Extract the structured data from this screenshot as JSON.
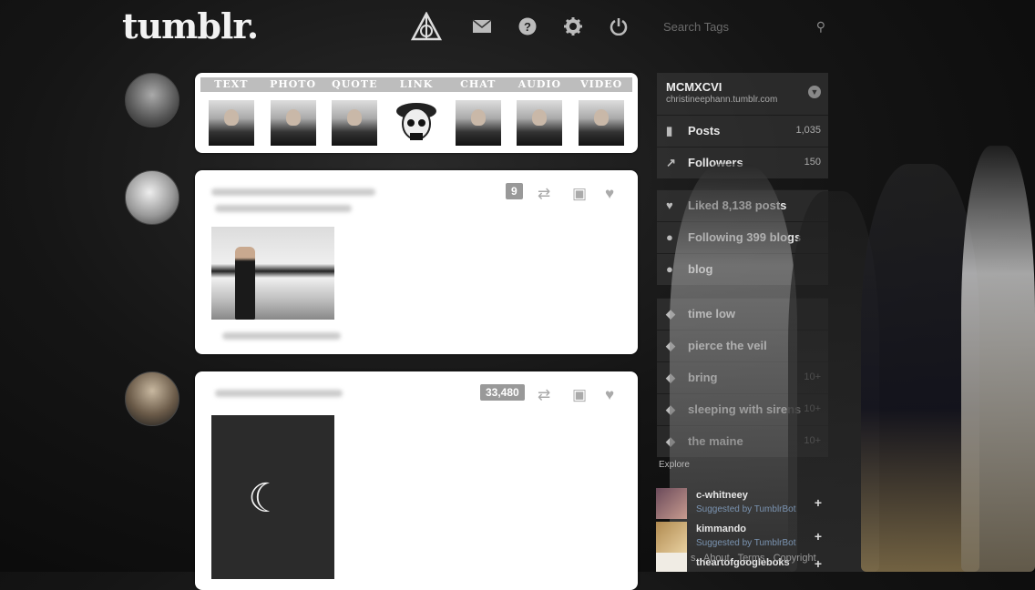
{
  "header": {
    "logo": "tumblr.",
    "nav_icons": [
      "deathly-hallows-icon",
      "mail-icon",
      "help-icon",
      "gear-icon",
      "power-icon"
    ],
    "search_placeholder": "Search Tags"
  },
  "post_types": [
    "TEXT",
    "PHOTO",
    "QUOTE",
    "LINK",
    "CHAT",
    "AUDIO",
    "VIDEO"
  ],
  "posts": [
    {
      "note_count": "9"
    },
    {
      "note_count": "33,480"
    }
  ],
  "sidebar": {
    "blog_name": "MCMXCVI",
    "blog_url": "christineephann.tumblr.com",
    "posts_label": "Posts",
    "posts_count": "1,035",
    "followers_label": "Followers",
    "followers_count": "150",
    "liked_label": "Liked 8,138 posts",
    "following_label": "Following 399 blogs",
    "blog_label": "blog",
    "tags": [
      {
        "label": "time low",
        "count": ""
      },
      {
        "label": "pierce the veil",
        "count": ""
      },
      {
        "label": "bring",
        "count": "10+"
      },
      {
        "label": "sleeping with sirens",
        "count": "10+"
      },
      {
        "label": "the maine",
        "count": "10+"
      }
    ]
  },
  "explore": {
    "label": "Explore",
    "suggestions": [
      {
        "user": "c-whitneey",
        "by": "Suggested by TumblrBot"
      },
      {
        "user": "kimmando",
        "by": "Suggested by TumblrBot"
      },
      {
        "user": "theartofgoogleboks",
        "by": ""
      }
    ]
  },
  "footer": [
    "s",
    "About",
    "Terms",
    "Copyright"
  ]
}
